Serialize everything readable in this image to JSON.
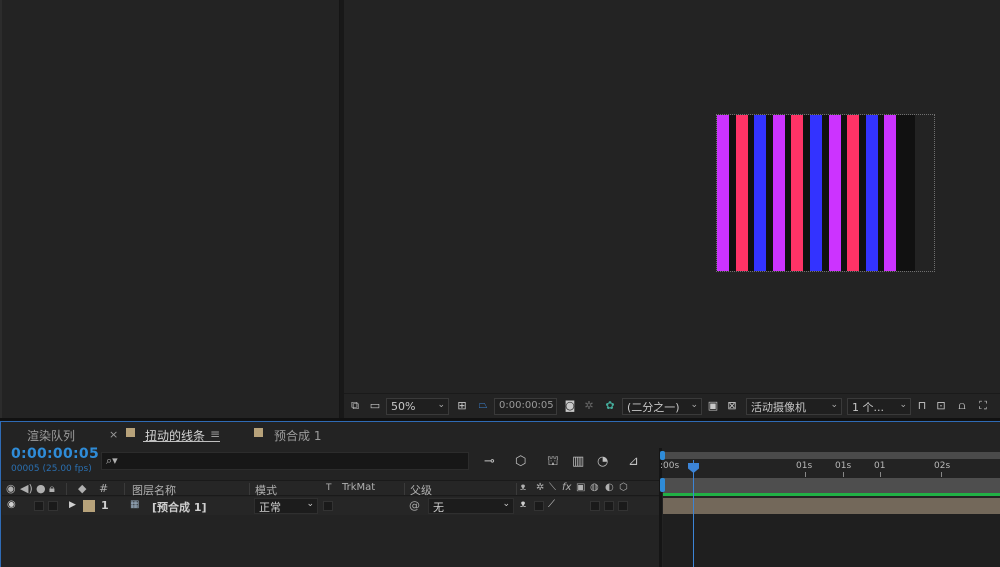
{
  "viewer": {
    "zoom": "50%",
    "timecode": "0:00:00:05",
    "resolution": "(二分之一)",
    "camera": "活动摄像机",
    "views": "1 个...",
    "stripe_colors": [
      "#cc33ff",
      "#ff3366",
      "#3333ff",
      "#cc33ff",
      "#ff3366",
      "#3333ff",
      "#cc33ff",
      "#ff3366",
      "#3333ff",
      "#cc33ff",
      "#111111"
    ]
  },
  "timeline": {
    "tabs": [
      {
        "label": "渲染队列"
      },
      {
        "label": "扭动的线条",
        "close": "×",
        "menu": "≡"
      },
      {
        "label": "预合成 1"
      }
    ],
    "timecode": "0:00:00:05",
    "frame_info": "00005 (25.00 fps)",
    "search_placeholder": "",
    "search_icon_glyph": "⌕▾",
    "columns": {
      "number": "#",
      "layer_name": "图层名称",
      "mode": "模式",
      "t": "T",
      "trkmat": "TrkMat",
      "parent": "父级"
    },
    "layer": {
      "number": "1",
      "name": "[预合成 1]",
      "mode": "正常",
      "parent": "无"
    },
    "ruler_labels": [
      ":00s",
      "01s",
      "01s",
      "01",
      "02s"
    ],
    "colors": {
      "accent": "#2f8cd8",
      "work_area_green": "#21b045",
      "layer_bar": "#73685a",
      "label_swatch": "#b7a27a"
    }
  }
}
